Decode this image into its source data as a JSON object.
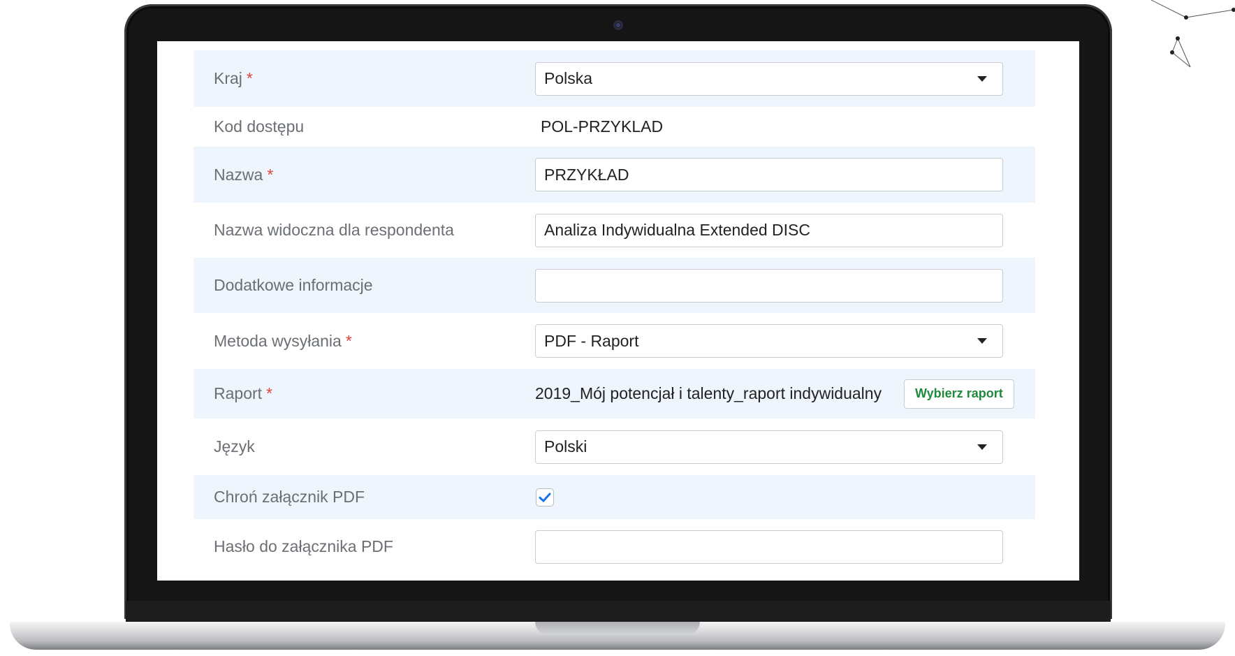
{
  "form": {
    "country": {
      "label": "Kraj",
      "required": "*",
      "value": "Polska"
    },
    "access_code": {
      "label": "Kod dostępu",
      "value": "POL-PRZYKLAD"
    },
    "name": {
      "label": "Nazwa",
      "required": "*",
      "value": "PRZYKŁAD"
    },
    "respondent_name": {
      "label": "Nazwa widoczna dla respondenta",
      "value": "Analiza Indywidualna Extended DISC"
    },
    "extra_info": {
      "label": "Dodatkowe informacje",
      "value": ""
    },
    "send_method": {
      "label": "Metoda wysyłania",
      "required": "*",
      "value": "PDF - Raport"
    },
    "report": {
      "label": "Raport",
      "required": "*",
      "value": "2019_Mój potencjał i talenty_raport indywidualny",
      "button_label": "Wybierz raport"
    },
    "language": {
      "label": "Język",
      "value": "Polski"
    },
    "protect_pdf": {
      "label": "Chroń załącznik PDF",
      "checked": true
    },
    "pdf_password": {
      "label": "Hasło do załącznika PDF",
      "value": ""
    }
  },
  "colors": {
    "row_shade": "#eef5fd",
    "required_mark": "#e0443a",
    "button_text": "#1f8a3b",
    "checkmark": "#1a73e8"
  }
}
